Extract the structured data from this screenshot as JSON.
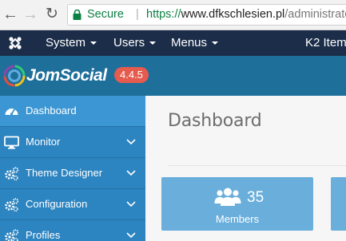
{
  "browser": {
    "secure_label": "Secure",
    "separator": "|",
    "url_scheme": "https://",
    "url_host": "www.dfkschlesien.pl",
    "url_path": "/administrato"
  },
  "topbar": {
    "menus": [
      {
        "label": "System"
      },
      {
        "label": "Users"
      },
      {
        "label": "Menus"
      },
      {
        "label": "K2 Item"
      }
    ]
  },
  "header": {
    "brand": "JomSocial",
    "version": "4.4.5"
  },
  "sidebar": {
    "items": [
      {
        "label": "Dashboard",
        "icon": "dashboard-icon",
        "active": true
      },
      {
        "label": "Monitor",
        "icon": "monitor-icon"
      },
      {
        "label": "Theme Designer",
        "icon": "cogs-icon"
      },
      {
        "label": "Configuration",
        "icon": "cogs-icon"
      },
      {
        "label": "Profiles",
        "icon": "cogs-icon"
      }
    ]
  },
  "main": {
    "title": "Dashboard",
    "stats": [
      {
        "value": "35",
        "label": "Members",
        "icon": "users-icon"
      }
    ]
  },
  "colors": {
    "joomla_bar": "#1b2d49",
    "header": "#1f6f9b",
    "sidebar": "#2c84c0",
    "sidebar_active": "#3b96d3",
    "badge": "#e55b4d",
    "stat_card": "#6aaedc",
    "secure": "#0b8043"
  }
}
